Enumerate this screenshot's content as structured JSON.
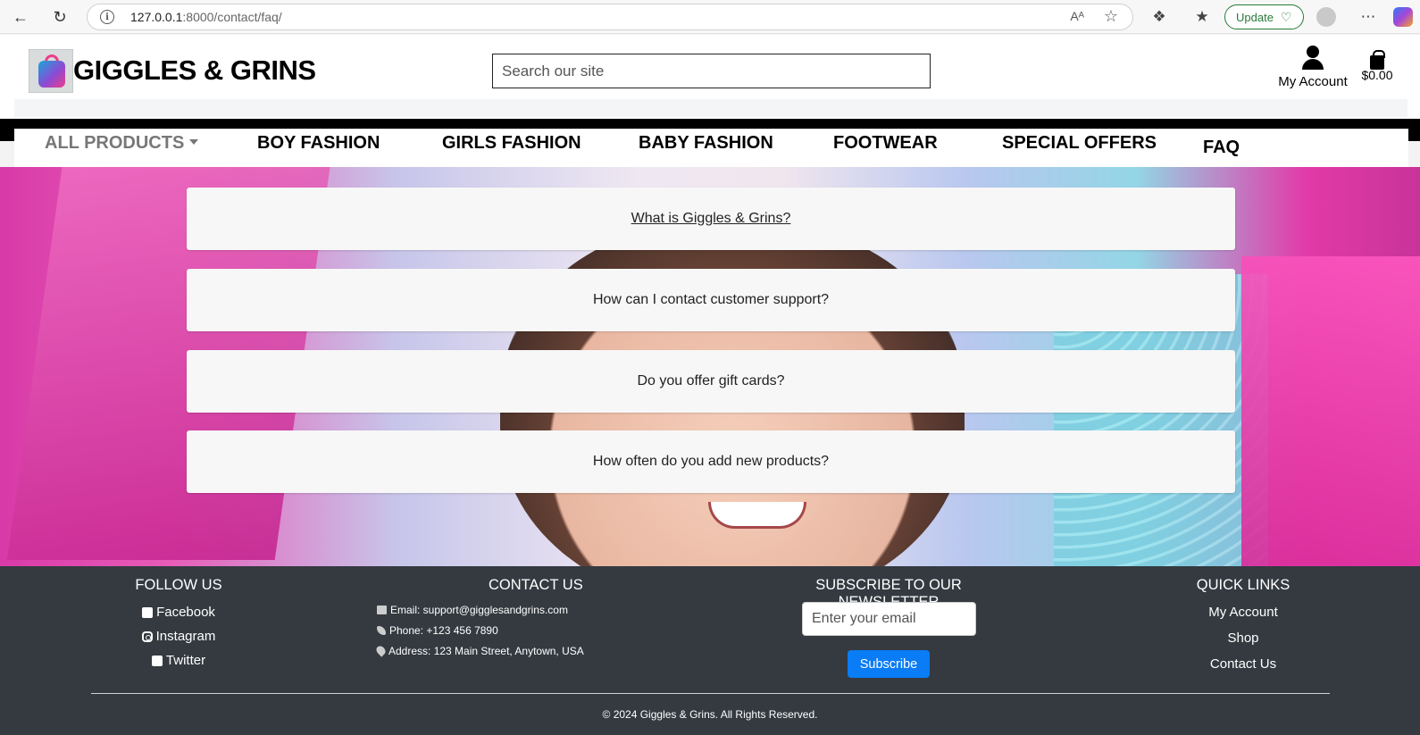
{
  "browser": {
    "url_host": "127.0.0.1",
    "url_rest": ":8000/contact/faq/",
    "read_aloud": "A̅",
    "update_label": "Update"
  },
  "site": {
    "logo_text": "GIGGLES & GRINS",
    "search_placeholder": "Search our site",
    "account_label": "My Account",
    "cart_total": "$0.00"
  },
  "nav": {
    "all_products": "ALL PRODUCTS",
    "boy": "BOY FASHION",
    "girls": "GIRLS FASHION",
    "baby": "BABY FASHION",
    "footwear": "FOOTWEAR",
    "offers": "SPECIAL OFFERS",
    "faq": "FAQ"
  },
  "faqs": [
    "What is Giggles & Grins?",
    "How can I contact customer support?",
    "Do you offer gift cards?",
    "How often do you add new products?"
  ],
  "footer": {
    "follow_title": "FOLLOW US",
    "facebook": "Facebook",
    "instagram": "Instagram",
    "twitter": "Twitter",
    "contact_title": "CONTACT US",
    "email": "Email: support@gigglesandgrins.com",
    "phone": "Phone: +123 456 7890",
    "address": "Address: 123 Main Street, Anytown, USA",
    "newsletter_title": "SUBSCRIBE TO OUR NEWSLETTER",
    "email_placeholder": "Enter your email",
    "subscribe_label": "Subscribe",
    "quick_title": "QUICK LINKS",
    "q_account": "My Account",
    "q_shop": "Shop",
    "q_contact": "Contact Us",
    "copyright": "© 2024 Giggles & Grins. All Rights Reserved."
  }
}
